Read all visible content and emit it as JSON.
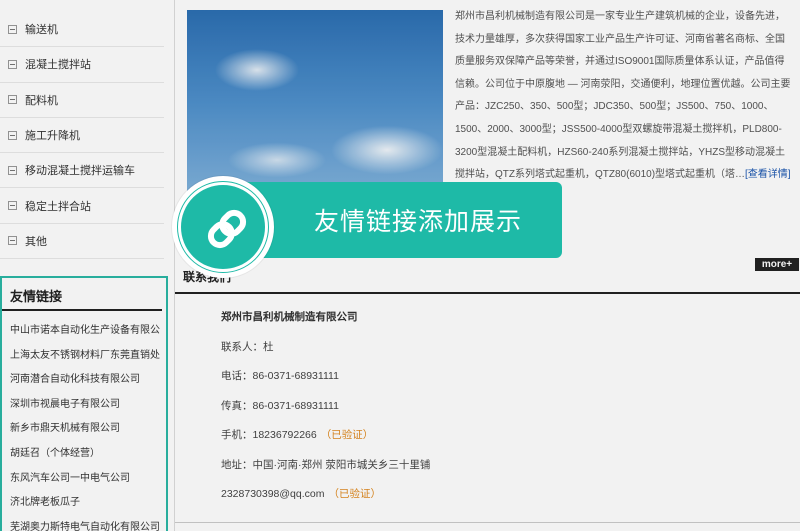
{
  "sidebar": {
    "categories": [
      "输送机",
      "混凝土搅拌站",
      "配料机",
      "施工升降机",
      "移动混凝土搅拌运输车",
      "稳定土拌合站",
      "其他"
    ],
    "links_title": "友情链接",
    "links": [
      "中山市诺本自动化生产设备有限公",
      "上海太友不锈钢材料厂东莞直销处",
      "河南潜合自动化科技有限公司",
      "深圳市视晨电子有限公司",
      "新乡市鼎天机械有限公司",
      "胡廷召（个体经营）",
      "东风汽车公司一中电气公司",
      "济北牌老板瓜子",
      "芜湖奥力斯特电气自动化有限公司"
    ]
  },
  "main": {
    "intro_text": "郑州市昌利机械制造有限公司是一家专业生产建筑机械的企业，设备先进，技术力量雄厚，多次获得国家工业产品生产许可证、河南省著名商标、全国质量服务双保障产品等荣誉，并通过ISO9001国际质量体系认证，产品值得信赖。公司位于中原腹地 — 河南荥阳，交通便利，地理位置优越。公司主要产品：JZC250、350、500型；JDC350、500型；JS500、750、1000、1500、2000、3000型；JSS500-4000型双螺旋带混凝土搅拌机，PLD800-3200型混凝土配料机，HZS60-240系列混凝土搅拌站，YHZS型移动混凝土搅拌站，QTZ系列塔式起重机，QTZ80(6010)型塔式起重机（塔…",
    "more_detail": "[查看详情]",
    "contact_title": "联系我们",
    "more_label": "more+",
    "contact": {
      "company": "郑州市昌利机械制造有限公司",
      "person": "联系人：杜",
      "phone": "电话：86-0371-68931111",
      "fax": "传真：86-0371-68931111",
      "mobile": "手机：18236792266",
      "mobile_status": "（已验证）",
      "address": "地址：中国·河南·郑州 荥阳市城关乡三十里铺",
      "email": "2328730398@qq.com",
      "email_status": "（已验证）"
    }
  },
  "banner": {
    "text": "友情链接添加展示",
    "icon": "chain-link-icon"
  },
  "colors": {
    "accent": "#1ebaa7",
    "verified": "#e08a1f",
    "link": "#1a56b0"
  }
}
